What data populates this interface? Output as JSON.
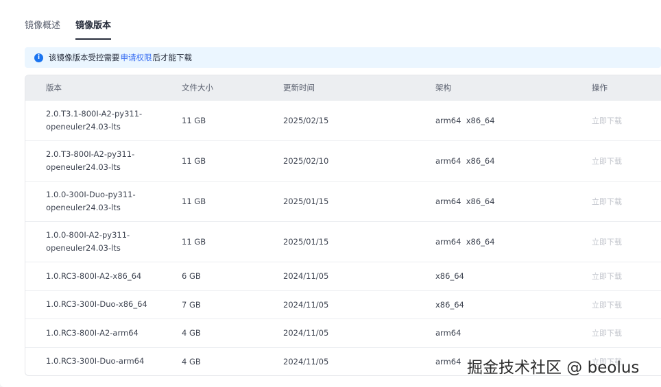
{
  "tabs": [
    "镜像概述",
    "镜像版本"
  ],
  "notice": {
    "before": "该镜像版本受控需要",
    "link": "申请权限",
    "after": "后才能下载"
  },
  "table": {
    "headers": [
      "版本",
      "文件大小",
      "更新时间",
      "架构",
      "操作"
    ],
    "rows": [
      {
        "version_line1": "2.0.T3.1-800I-A2-py311-",
        "version_line2": "openeuler24.03-lts",
        "size": "11 GB",
        "updated": "2025/02/15",
        "arch": "arm64  x86_64",
        "action": "立即下载"
      },
      {
        "version_line1": "2.0.T3-800I-A2-py311-",
        "version_line2": "openeuler24.03-lts",
        "size": "11 GB",
        "updated": "2025/02/10",
        "arch": "arm64  x86_64",
        "action": "立即下载"
      },
      {
        "version_line1": "1.0.0-300I-Duo-py311-",
        "version_line2": "openeuler24.03-lts",
        "size": "11 GB",
        "updated": "2025/01/15",
        "arch": "arm64  x86_64",
        "action": "立即下载"
      },
      {
        "version_line1": "1.0.0-800I-A2-py311-",
        "version_line2": "openeuler24.03-lts",
        "size": "11 GB",
        "updated": "2025/01/15",
        "arch": "arm64  x86_64",
        "action": "立即下载"
      },
      {
        "version_line1": "1.0.RC3-800I-A2-x86_64",
        "version_line2": "",
        "size": "6 GB",
        "updated": "2024/11/05",
        "arch": "x86_64",
        "action": "立即下载"
      },
      {
        "version_line1": "1.0.RC3-300I-Duo-x86_64",
        "version_line2": "",
        "size": "7 GB",
        "updated": "2024/11/05",
        "arch": "x86_64",
        "action": "立即下载"
      },
      {
        "version_line1": "1.0.RC3-800I-A2-arm64",
        "version_line2": "",
        "size": "4 GB",
        "updated": "2024/11/05",
        "arch": "arm64",
        "action": "立即下载"
      },
      {
        "version_line1": "1.0.RC3-300I-Duo-arm64",
        "version_line2": "",
        "size": "4 GB",
        "updated": "2024/11/05",
        "arch": "arm64",
        "action": "立即下载"
      }
    ]
  },
  "watermark": "掘金技术社区 @ beolus"
}
